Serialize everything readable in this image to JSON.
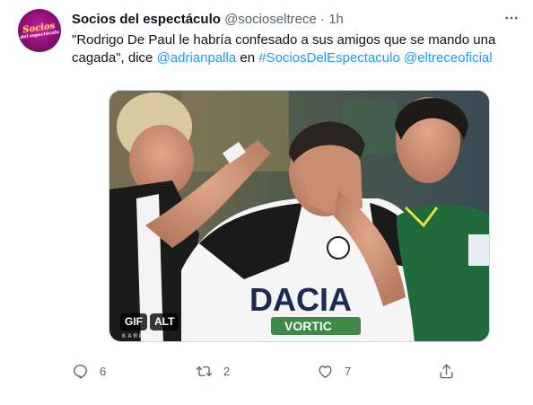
{
  "tweet": {
    "author_name": "Socios del espectáculo",
    "author_handle": "@socioseltrece",
    "separator": "·",
    "time": "1h",
    "avatar_logo_text": "Socios",
    "avatar_logo_subtext": "del espectáculo",
    "text_prefix": "\"Rodrigo De Paul le habría confesado a sus amigos que se mando una cagada\", dice ",
    "mention_1": "@adrianpalla",
    "text_middle": " en ",
    "hashtag": "#SociosDelEspectaculo",
    "mention_2": "@eltreceoficial"
  },
  "media": {
    "gif_badge": "GIF",
    "alt_badge": "ALT",
    "watermark": "KARIM",
    "jersey_text": "DACIA",
    "sponsor_text": "VORTIC"
  },
  "actions": {
    "reply_count": "6",
    "retweet_count": "2",
    "like_count": "7"
  },
  "icons": [
    "more-icon",
    "reply-icon",
    "retweet-icon",
    "like-icon",
    "share-icon"
  ]
}
